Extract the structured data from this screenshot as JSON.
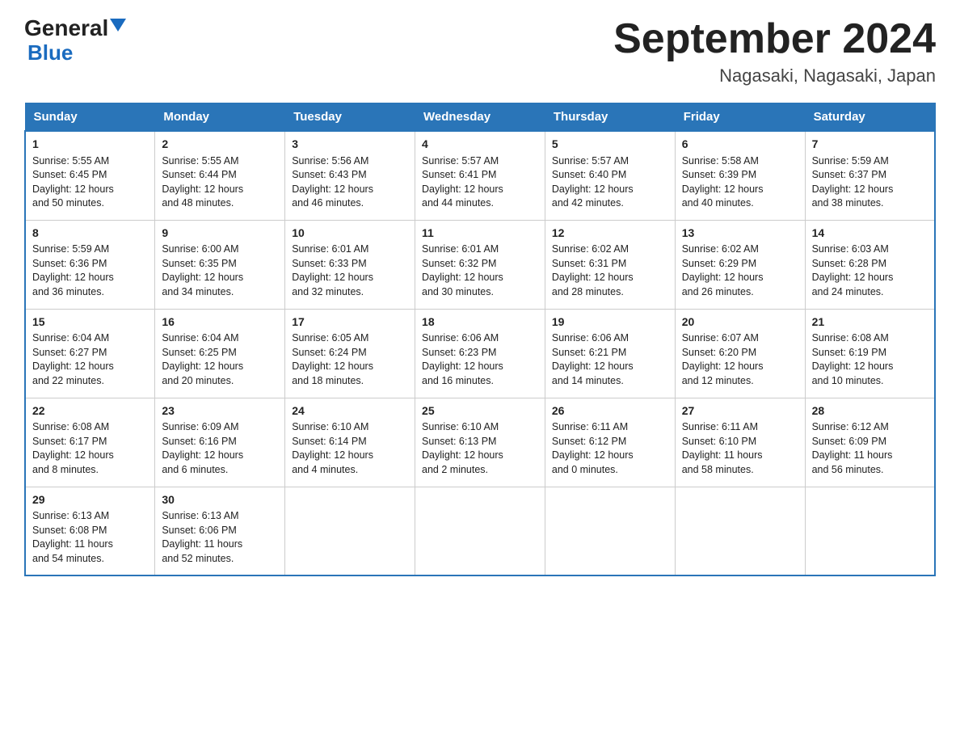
{
  "header": {
    "logo_general": "General",
    "logo_blue": "Blue",
    "month_title": "September 2024",
    "location": "Nagasaki, Nagasaki, Japan"
  },
  "days_of_week": [
    "Sunday",
    "Monday",
    "Tuesday",
    "Wednesday",
    "Thursday",
    "Friday",
    "Saturday"
  ],
  "weeks": [
    [
      {
        "day": "1",
        "sunrise": "5:55 AM",
        "sunset": "6:45 PM",
        "daylight": "12 hours and 50 minutes."
      },
      {
        "day": "2",
        "sunrise": "5:55 AM",
        "sunset": "6:44 PM",
        "daylight": "12 hours and 48 minutes."
      },
      {
        "day": "3",
        "sunrise": "5:56 AM",
        "sunset": "6:43 PM",
        "daylight": "12 hours and 46 minutes."
      },
      {
        "day": "4",
        "sunrise": "5:57 AM",
        "sunset": "6:41 PM",
        "daylight": "12 hours and 44 minutes."
      },
      {
        "day": "5",
        "sunrise": "5:57 AM",
        "sunset": "6:40 PM",
        "daylight": "12 hours and 42 minutes."
      },
      {
        "day": "6",
        "sunrise": "5:58 AM",
        "sunset": "6:39 PM",
        "daylight": "12 hours and 40 minutes."
      },
      {
        "day": "7",
        "sunrise": "5:59 AM",
        "sunset": "6:37 PM",
        "daylight": "12 hours and 38 minutes."
      }
    ],
    [
      {
        "day": "8",
        "sunrise": "5:59 AM",
        "sunset": "6:36 PM",
        "daylight": "12 hours and 36 minutes."
      },
      {
        "day": "9",
        "sunrise": "6:00 AM",
        "sunset": "6:35 PM",
        "daylight": "12 hours and 34 minutes."
      },
      {
        "day": "10",
        "sunrise": "6:01 AM",
        "sunset": "6:33 PM",
        "daylight": "12 hours and 32 minutes."
      },
      {
        "day": "11",
        "sunrise": "6:01 AM",
        "sunset": "6:32 PM",
        "daylight": "12 hours and 30 minutes."
      },
      {
        "day": "12",
        "sunrise": "6:02 AM",
        "sunset": "6:31 PM",
        "daylight": "12 hours and 28 minutes."
      },
      {
        "day": "13",
        "sunrise": "6:02 AM",
        "sunset": "6:29 PM",
        "daylight": "12 hours and 26 minutes."
      },
      {
        "day": "14",
        "sunrise": "6:03 AM",
        "sunset": "6:28 PM",
        "daylight": "12 hours and 24 minutes."
      }
    ],
    [
      {
        "day": "15",
        "sunrise": "6:04 AM",
        "sunset": "6:27 PM",
        "daylight": "12 hours and 22 minutes."
      },
      {
        "day": "16",
        "sunrise": "6:04 AM",
        "sunset": "6:25 PM",
        "daylight": "12 hours and 20 minutes."
      },
      {
        "day": "17",
        "sunrise": "6:05 AM",
        "sunset": "6:24 PM",
        "daylight": "12 hours and 18 minutes."
      },
      {
        "day": "18",
        "sunrise": "6:06 AM",
        "sunset": "6:23 PM",
        "daylight": "12 hours and 16 minutes."
      },
      {
        "day": "19",
        "sunrise": "6:06 AM",
        "sunset": "6:21 PM",
        "daylight": "12 hours and 14 minutes."
      },
      {
        "day": "20",
        "sunrise": "6:07 AM",
        "sunset": "6:20 PM",
        "daylight": "12 hours and 12 minutes."
      },
      {
        "day": "21",
        "sunrise": "6:08 AM",
        "sunset": "6:19 PM",
        "daylight": "12 hours and 10 minutes."
      }
    ],
    [
      {
        "day": "22",
        "sunrise": "6:08 AM",
        "sunset": "6:17 PM",
        "daylight": "12 hours and 8 minutes."
      },
      {
        "day": "23",
        "sunrise": "6:09 AM",
        "sunset": "6:16 PM",
        "daylight": "12 hours and 6 minutes."
      },
      {
        "day": "24",
        "sunrise": "6:10 AM",
        "sunset": "6:14 PM",
        "daylight": "12 hours and 4 minutes."
      },
      {
        "day": "25",
        "sunrise": "6:10 AM",
        "sunset": "6:13 PM",
        "daylight": "12 hours and 2 minutes."
      },
      {
        "day": "26",
        "sunrise": "6:11 AM",
        "sunset": "6:12 PM",
        "daylight": "12 hours and 0 minutes."
      },
      {
        "day": "27",
        "sunrise": "6:11 AM",
        "sunset": "6:10 PM",
        "daylight": "11 hours and 58 minutes."
      },
      {
        "day": "28",
        "sunrise": "6:12 AM",
        "sunset": "6:09 PM",
        "daylight": "11 hours and 56 minutes."
      }
    ],
    [
      {
        "day": "29",
        "sunrise": "6:13 AM",
        "sunset": "6:08 PM",
        "daylight": "11 hours and 54 minutes."
      },
      {
        "day": "30",
        "sunrise": "6:13 AM",
        "sunset": "6:06 PM",
        "daylight": "11 hours and 52 minutes."
      },
      null,
      null,
      null,
      null,
      null
    ]
  ]
}
